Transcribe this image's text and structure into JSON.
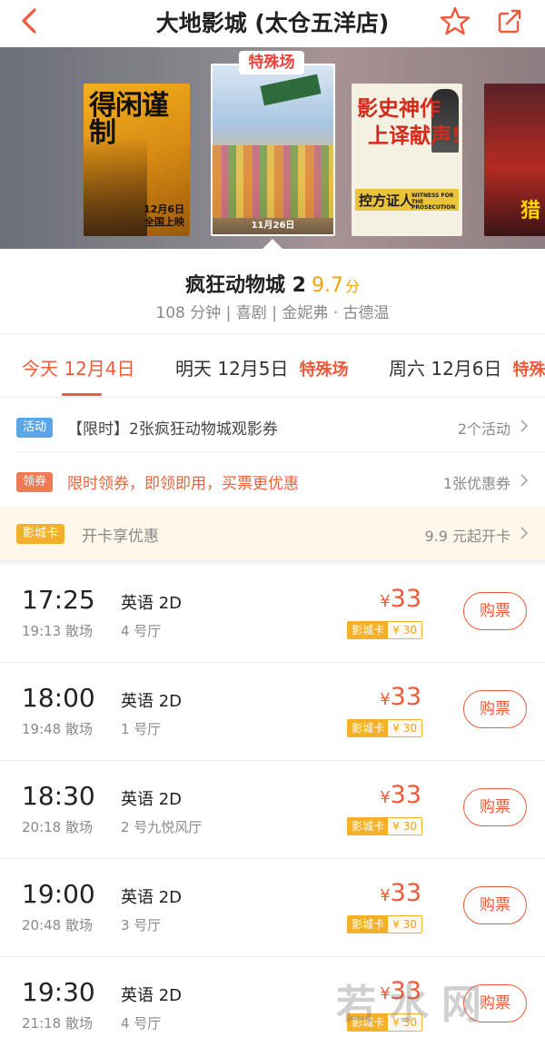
{
  "header": {
    "title": "大地影城 (太仓五洋店)",
    "back_icon": "chevron-left-icon",
    "favorite_icon": "star-icon",
    "share_icon": "share-icon",
    "accent_color": "#f05a3a"
  },
  "posters": {
    "p1_title": "得闲谨制",
    "p1_date": "12月6日",
    "p1_release": "全国上映",
    "p2_badge": "特殊场",
    "p2_date": "11月26日",
    "p3_title_1": "影史神作",
    "p3_title_2": "上译献声!",
    "p3_band": "控方证人",
    "p3_band_en": "WITNESS FOR THE PROSECUTION",
    "p4_text": "猎"
  },
  "movie": {
    "name": "疯狂动物城 2",
    "score": "9.7",
    "score_unit": "分",
    "meta": "108 分钟 | 喜剧 | 金妮弗 · 古德温"
  },
  "date_tabs": [
    {
      "label": "今天 12月4日",
      "special": ""
    },
    {
      "label": "明天 12月5日",
      "special": "特殊场"
    },
    {
      "label": "周六 12月6日",
      "special": "特殊"
    }
  ],
  "promos": [
    {
      "tag": "活动",
      "text": "【限时】2张疯狂动物城观影券",
      "right": "2个活动"
    },
    {
      "tag": "领券",
      "text": "限时领券，即领即用，买票更优惠",
      "right": "1张优惠券"
    },
    {
      "tag": "影城卡",
      "text": "开卡享优惠",
      "right": "9.9 元起开卡"
    }
  ],
  "showtimes": [
    {
      "time": "17:25",
      "end": "19:13 散场",
      "lang": "英语 2D",
      "hall": "4 号厅",
      "price": "33",
      "card_label": "影城卡",
      "card_price": "¥ 30",
      "buy": "购票"
    },
    {
      "time": "18:00",
      "end": "19:48 散场",
      "lang": "英语 2D",
      "hall": "1 号厅",
      "price": "33",
      "card_label": "影城卡",
      "card_price": "¥ 30",
      "buy": "购票"
    },
    {
      "time": "18:30",
      "end": "20:18 散场",
      "lang": "英语 2D",
      "hall": "2 号九悦风厅",
      "price": "33",
      "card_label": "影城卡",
      "card_price": "¥ 30",
      "buy": "购票"
    },
    {
      "time": "19:00",
      "end": "20:48 散场",
      "lang": "英语 2D",
      "hall": "3 号厅",
      "price": "33",
      "card_label": "影城卡",
      "card_price": "¥ 30",
      "buy": "购票"
    },
    {
      "time": "19:30",
      "end": "21:18 散场",
      "lang": "英语 2D",
      "hall": "4 号厅",
      "price": "33",
      "card_label": "影城卡",
      "card_price": "¥ 30",
      "buy": "购票"
    }
  ],
  "currency_symbol": "¥",
  "watermark": "若水网"
}
